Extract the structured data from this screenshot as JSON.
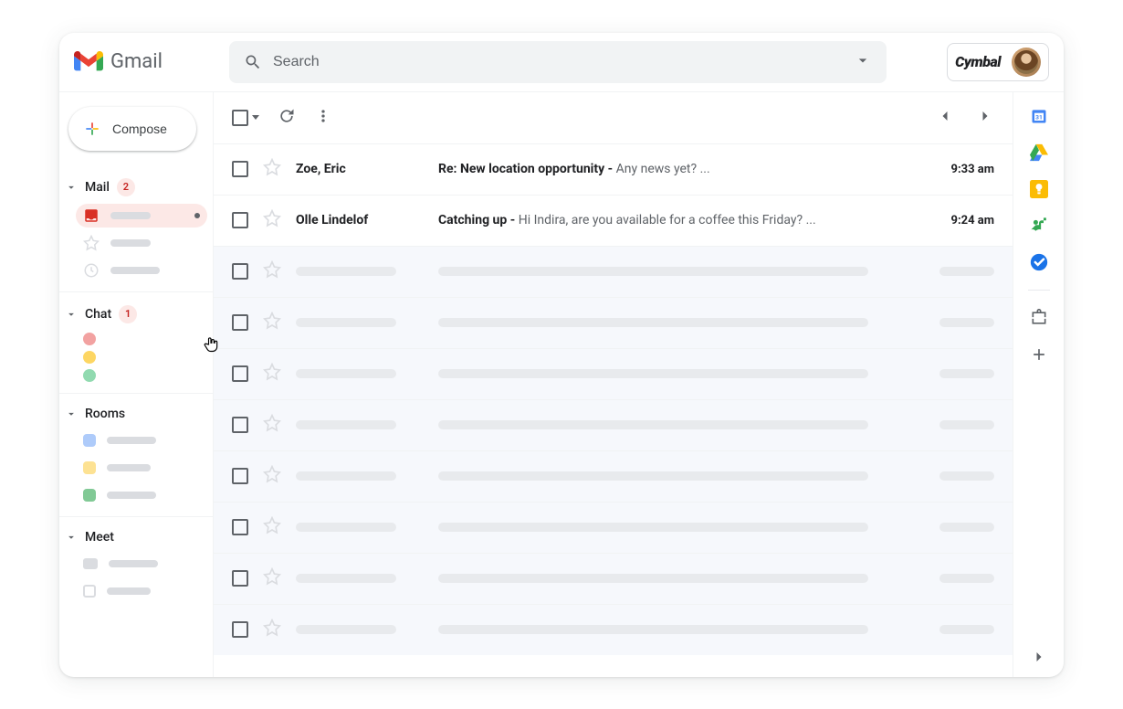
{
  "app_name": "Gmail",
  "search": {
    "placeholder": "Search"
  },
  "brand_label": "Cymbal",
  "compose_label": "Compose",
  "sections": {
    "mail": {
      "label": "Mail",
      "badge": "2"
    },
    "chat": {
      "label": "Chat",
      "badge": "1"
    },
    "rooms": {
      "label": "Rooms"
    },
    "meet": {
      "label": "Meet"
    }
  },
  "messages": [
    {
      "sender": "Zoe, Eric",
      "subject": "Re: New location opportunity",
      "snippet": "Any news yet? ...",
      "time": "9:33 am",
      "read": false
    },
    {
      "sender": "Olle Lindelof",
      "subject": "Catching up",
      "snippet": "Hi Indira, are you available for a coffee this Friday? ...",
      "time": "9:24 am",
      "read": false
    }
  ],
  "placeholder_rows": 8,
  "rail": {
    "calendar_day": "31"
  }
}
